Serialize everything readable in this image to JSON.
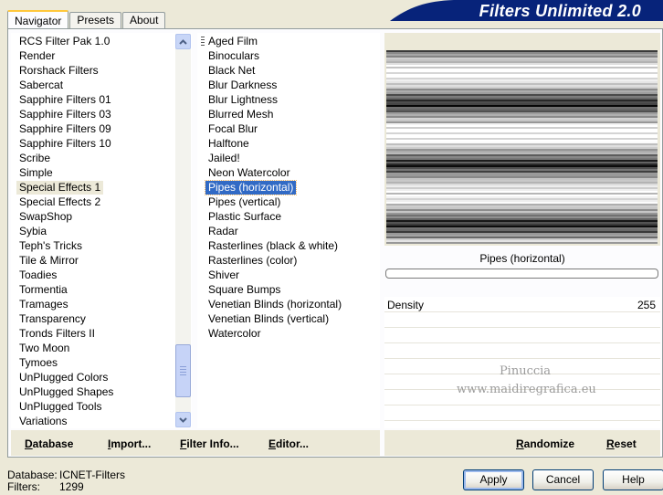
{
  "tabs": [
    "Navigator",
    "Presets",
    "About"
  ],
  "banner_title": "Filters Unlimited 2.0",
  "categories": [
    "RCS Filter Pak 1.0",
    "Render",
    "Rorshack Filters",
    "Sabercat",
    "Sapphire Filters 01",
    "Sapphire Filters 03",
    "Sapphire Filters 09",
    "Sapphire Filters 10",
    "Scribe",
    "Simple",
    "Special Effects 1",
    "Special Effects 2",
    "SwapShop",
    "Sybia",
    "Teph's Tricks",
    "Tile & Mirror",
    "Toadies",
    "Tormentia",
    "Tramages",
    "Transparency",
    "Tronds Filters II",
    "Two Moon",
    "Tymoes",
    "UnPlugged Colors",
    "UnPlugged Shapes",
    "UnPlugged Tools",
    "Variations"
  ],
  "selected_category": "Special Effects 1",
  "filters": [
    "Aged Film",
    "Binoculars",
    "Black Net",
    "Blur Darkness",
    "Blur Lightness",
    "Blurred Mesh",
    "Focal Blur",
    "Halftone",
    "Jailed!",
    "Neon Watercolor",
    "Pipes (horizontal)",
    "Pipes (vertical)",
    "Plastic Surface",
    "Radar",
    "Rasterlines (black & white)",
    "Rasterlines (color)",
    "Shiver",
    "Square Bumps",
    "Venetian Blinds (horizontal)",
    "Venetian Blinds (vertical)",
    "Watercolor"
  ],
  "selected_filter": "Pipes (horizontal)",
  "preview": {
    "filter_name": "Pipes (horizontal)"
  },
  "params": [
    {
      "name": "Density",
      "value": "255"
    }
  ],
  "watermark": {
    "line1": "Pinuccia",
    "line2": "www.maidiregrafica.eu"
  },
  "toolbar": {
    "database": "Database",
    "import": "Import...",
    "filter_info": "Filter Info...",
    "editor": "Editor...",
    "randomize": "Randomize",
    "reset": "Reset"
  },
  "status": {
    "database_label": "Database:",
    "database_value": "ICNET-Filters",
    "filters_label": "Filters:",
    "filters_value": "1299"
  },
  "buttons": {
    "apply": "Apply",
    "cancel": "Cancel",
    "help": "Help"
  },
  "colors": {
    "banner": "#07237a",
    "selection": "#316ac5",
    "accent_tab": "#ffc83c"
  }
}
